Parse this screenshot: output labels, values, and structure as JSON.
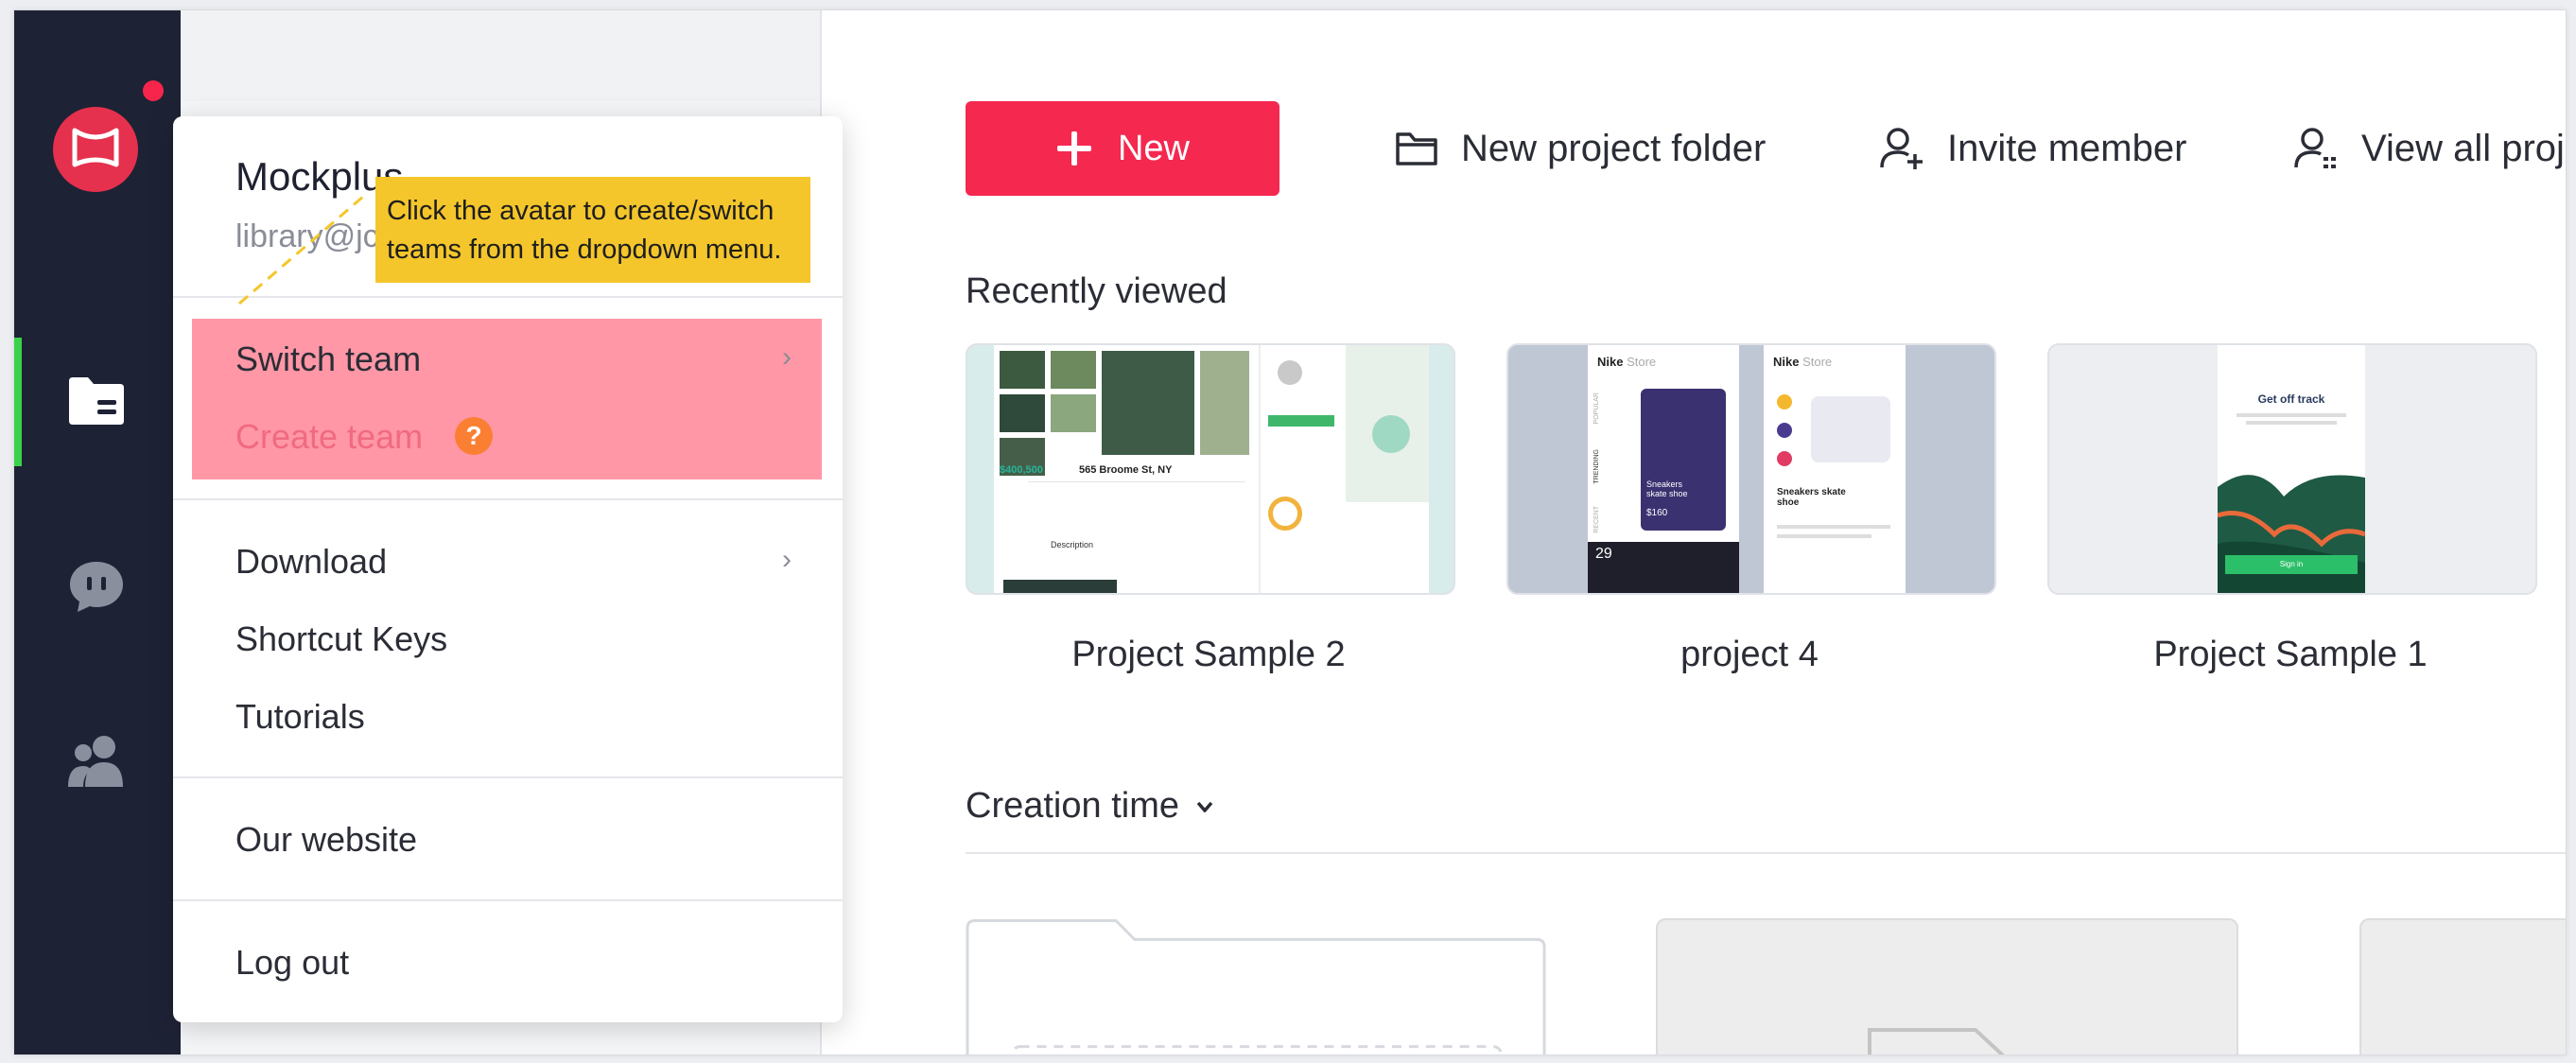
{
  "sidebar": {
    "logo_icon": "mockplus-logo",
    "items": [
      {
        "icon": "folder-list-icon",
        "active": true
      },
      {
        "icon": "chat-icon",
        "active": false
      },
      {
        "icon": "team-members-icon",
        "active": false
      }
    ],
    "accent": "#3bd14a",
    "background": "#1e2235",
    "notification_color": "#f7254b"
  },
  "toolbar": {
    "new_label": "New",
    "new_folder_label": "New project folder",
    "invite_label": "Invite member",
    "view_all_label": "View all proje"
  },
  "recent": {
    "title": "Recently viewed",
    "projects": [
      {
        "name": "Project Sample 2"
      },
      {
        "name": "project 4"
      },
      {
        "name": "Project Sample 1"
      }
    ]
  },
  "sort": {
    "label": "Creation time"
  },
  "user_menu": {
    "name": "Mockplus",
    "email": "library@jc",
    "switch_team": "Switch team",
    "create_team": "Create team",
    "help_glyph": "?",
    "download": "Download",
    "shortcut_keys": "Shortcut Keys",
    "tutorials": "Tutorials",
    "our_website": "Our website",
    "log_out": "Log out"
  },
  "tooltip": {
    "line1": "Click the avatar to create/switch",
    "line2": "teams from the dropdown menu."
  },
  "thumbnails": {
    "card1": {
      "price": "$400,500",
      "address": "565 Broome St, NY",
      "desc": "Description"
    },
    "card2": {
      "brand": "Nike",
      "store": "Store",
      "product1": "Sneakers skate shoe",
      "price1": "$160",
      "product2": "Sneakers skate shoe",
      "day": "29",
      "tab1": "POPULAR",
      "tab2": "TRENDING",
      "tab3": "RECENT"
    },
    "card3": {
      "title": "Get off track",
      "cta": "Sign in"
    }
  },
  "colors": {
    "brand_red": "#f52850",
    "highlight_pink": "#ff97a6",
    "tooltip_yellow": "#f4c62b",
    "help_orange": "#fb7f33"
  }
}
